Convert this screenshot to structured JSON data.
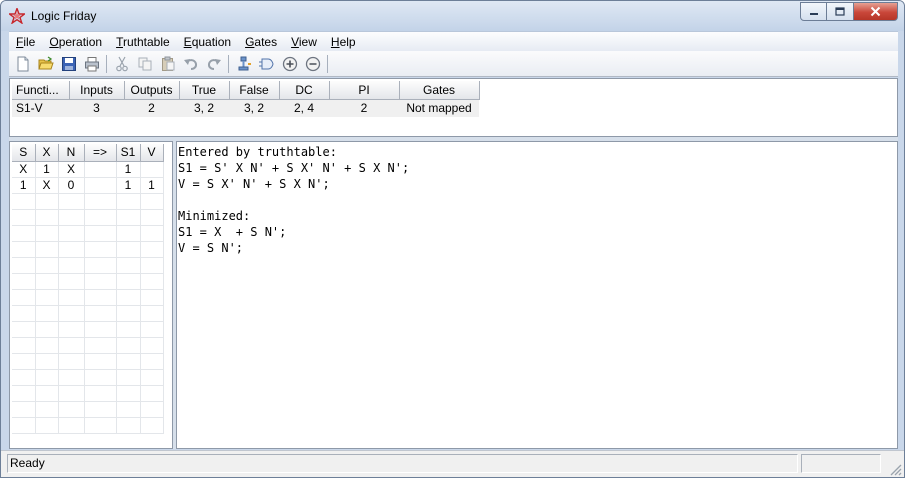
{
  "window": {
    "title": "Logic Friday",
    "icon": "app-star-icon"
  },
  "menu": [
    {
      "key": "F",
      "rest": "ile"
    },
    {
      "key": "O",
      "rest": "peration"
    },
    {
      "key": "T",
      "rest": "ruthtable"
    },
    {
      "key": "E",
      "rest": "quation"
    },
    {
      "key": "G",
      "rest": "ates"
    },
    {
      "key": "V",
      "rest": "iew"
    },
    {
      "key": "H",
      "rest": "elp"
    }
  ],
  "toolbar": {
    "icons": [
      "new-file-icon",
      "open-folder-icon",
      "save-icon",
      "print-icon",
      "cut-icon",
      "copy-icon",
      "paste-icon",
      "undo-icon",
      "redo-icon",
      "minimize-logic-icon",
      "gate-icon",
      "add-icon",
      "remove-icon"
    ]
  },
  "functions": {
    "headers": [
      "Functi...",
      "Inputs",
      "Outputs",
      "True",
      "False",
      "DC",
      "PI",
      "Gates"
    ],
    "rows": [
      [
        "S1-V",
        "3",
        "2",
        "3, 2",
        "3, 2",
        "2, 4",
        "2",
        "Not mapped"
      ]
    ]
  },
  "truthtable": {
    "headers": [
      "S",
      "X",
      "N",
      "=>",
      "S1",
      "V"
    ],
    "rows": [
      [
        "X",
        "1",
        "X",
        "",
        "1",
        ""
      ],
      [
        "1",
        "X",
        "0",
        "",
        "1",
        "1"
      ]
    ]
  },
  "equations": {
    "lines": [
      "Entered by truthtable:",
      "S1 = S' X N' + S X' N' + S X N';",
      "V = S X' N' + S X N';",
      "",
      "Minimized:",
      "S1 = X  + S N';",
      "V = S N';"
    ]
  },
  "status": {
    "text": "Ready"
  },
  "colors": {
    "window_frame": "#c9d7ea",
    "close_button": "#c9473a"
  }
}
